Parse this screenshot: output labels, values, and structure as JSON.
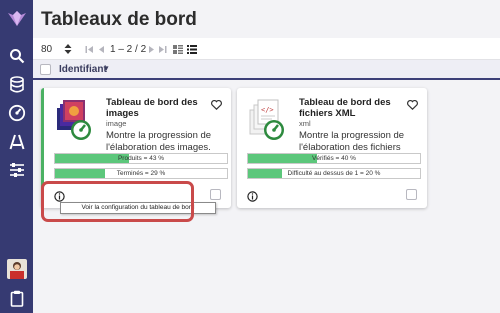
{
  "header": {
    "title": "Tableaux de bord"
  },
  "sidebar": {
    "items": [
      {
        "icon": "logo-icon"
      },
      {
        "icon": "search-icon"
      },
      {
        "icon": "database-icon"
      },
      {
        "icon": "dashboard-gauge-icon"
      },
      {
        "icon": "road-icon"
      },
      {
        "icon": "sliders-icon"
      },
      {
        "icon": "user-avatar"
      },
      {
        "icon": "clipboard-icon"
      }
    ]
  },
  "toolbar": {
    "page_size": "80",
    "pagination": "1 – 2 / 2"
  },
  "column_header": {
    "label": "Identifiant",
    "caret": "▾"
  },
  "cards": [
    {
      "title": "Tableau de bord des images",
      "subtitle": "image",
      "description": "Montre la progression de l'élaboration des images.",
      "bars": [
        {
          "label": "Produits = 43 %",
          "value": 0.43
        },
        {
          "label": "Terminés = 29 %",
          "value": 0.29
        }
      ]
    },
    {
      "title": "Tableau de bord des fichiers XML",
      "subtitle": "xml",
      "description": "Montre la progression de l'élaboration des fichiers XML.",
      "bars": [
        {
          "label": "Vérifiés = 40 %",
          "value": 0.4
        },
        {
          "label": "Difficulté au dessus de 1 = 20 %",
          "value": 0.2
        }
      ]
    }
  ],
  "tooltip": {
    "text": "Voir la configuration du tableau de bord"
  },
  "colors": {
    "sidebar": "#363a72",
    "accent": "#4bb163",
    "highlight": "#c94a4a",
    "bar_fill": "#5cc77b"
  }
}
